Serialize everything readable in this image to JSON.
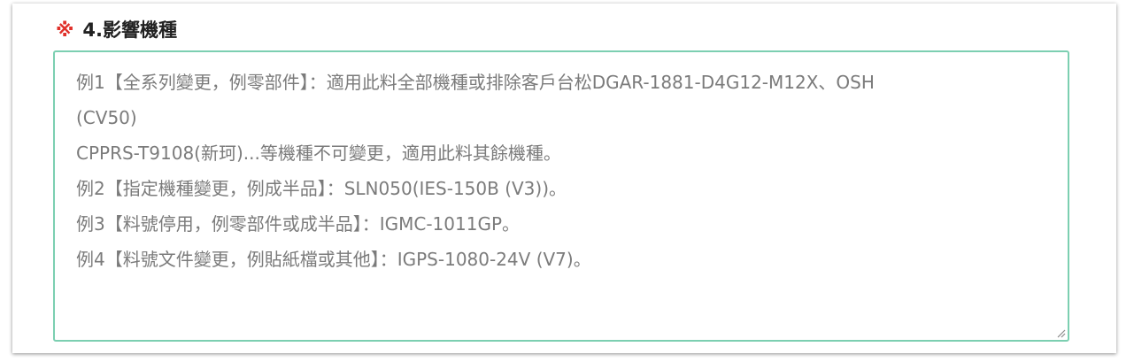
{
  "section": {
    "required_mark": "※",
    "title": "4.影響機種"
  },
  "field": {
    "placeholder_lines": [
      "例1【全系列變更，例零部件】：適用此料全部機種或排除客戶台松DGAR-1881-D4G12-M12X、OSH",
      "(CV50)",
      "CPPRS-T9108(新珂)...等機種不可變更，適用此料其餘機種。",
      "例2【指定機種變更，例成半品】：SLN050(IES-150B (V3))。",
      "例3【料號停用，例零部件或成半品】：IGMC-1011GP。",
      "例4【料號文件變更，例貼紙檔或其他】：IGPS-1080-24V (V7)。"
    ],
    "value": ""
  },
  "colors": {
    "required": "#e0302a",
    "focus_border": "#7ccfb1",
    "placeholder": "#7b7b7b"
  },
  "icons": {
    "resize": "resize-handle-icon"
  }
}
